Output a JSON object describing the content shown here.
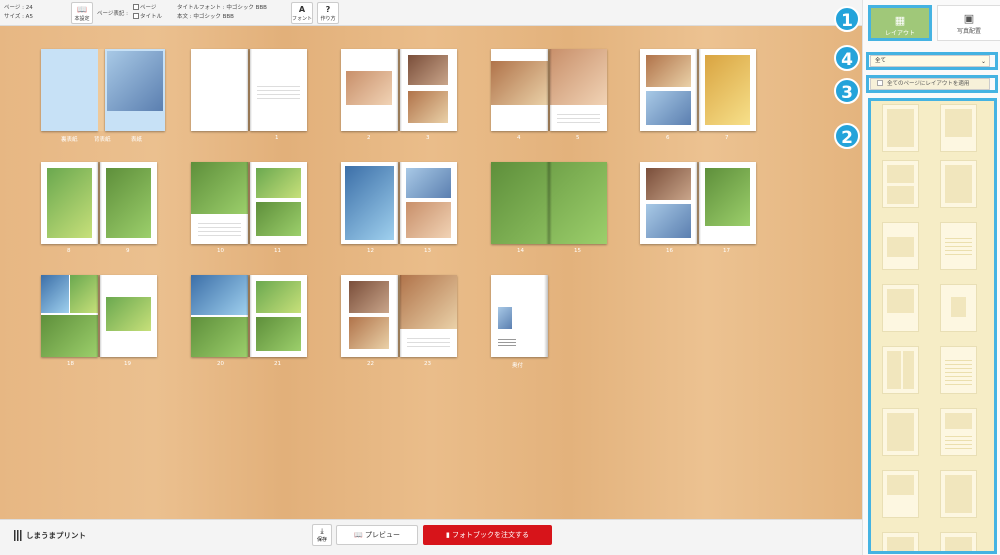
{
  "toolbar": {
    "pages": "ページ : 24",
    "size": "サイズ : A5",
    "book_settings": "本設定",
    "page_display": "ページ表記 :",
    "check_page": "ページ",
    "check_title": "タイトル",
    "title_font": "タイトルフォント : 中ゴシック BBB",
    "body_font": "本文 : 中ゴシック BBB",
    "font_btn": "フォント",
    "howto_btn": "作り方"
  },
  "canvas": {
    "labels": {
      "cover": [
        "裏表紙",
        "背表紙",
        "表紙"
      ],
      "s1": "1",
      "s2": [
        "2",
        "3"
      ],
      "s3": [
        "4",
        "5"
      ],
      "s4": [
        "6",
        "7"
      ],
      "s5": [
        "8",
        "9"
      ],
      "s6": [
        "10",
        "11"
      ],
      "s7": [
        "12",
        "13"
      ],
      "s8": [
        "14",
        "15"
      ],
      "s9": [
        "16",
        "17"
      ],
      "s10": [
        "18",
        "19"
      ],
      "s11": [
        "20",
        "21"
      ],
      "s12": [
        "22",
        "23"
      ],
      "s13": "奥付"
    }
  },
  "bottom": {
    "logo": "しまうまプリント",
    "save": "保存",
    "preview": "プレビュー",
    "order": "フォトブックを注文する"
  },
  "sidebar": {
    "tab_layout": "レイアウト",
    "tab_photo": "写真配置",
    "filter_value": "全て",
    "apply_all": "全てのページにレイアウトを適用"
  },
  "badges": {
    "b1": "1",
    "b2": "2",
    "b3": "3",
    "b4": "4"
  },
  "colors": {
    "accent": "#45b3e2",
    "order": "#d7141a",
    "layout_tab": "#a0c879"
  }
}
